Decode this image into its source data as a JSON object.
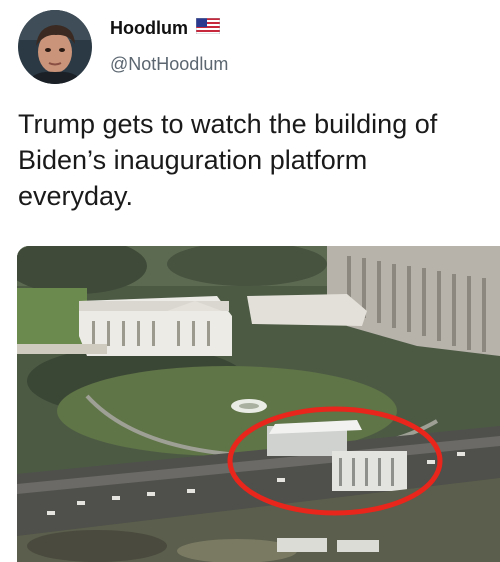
{
  "tweet": {
    "display_name": "Hoodlum",
    "handle": "@NotHoodlum",
    "text": "Trump gets to watch the building of Biden’s inauguration platform everyday.",
    "flag": "us-flag-icon"
  },
  "colors": {
    "handle": "#5b6670",
    "highlight_circle": "#e8261b"
  }
}
